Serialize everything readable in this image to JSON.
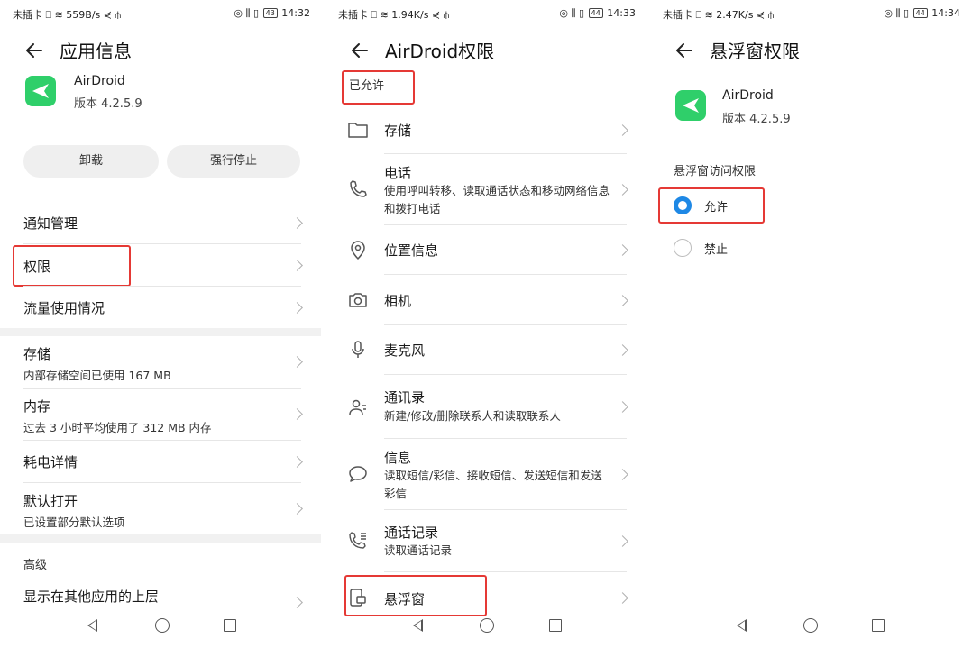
{
  "colors": {
    "accent": "#1e88e5",
    "app_green": "#2fcf6a",
    "highlight_red": "#e53935"
  },
  "screen1": {
    "status": {
      "left": "未插卡 ⎕ ≋ 559B/s ⋞ ⫛",
      "icons_right": "◎ ⫼ ▯",
      "battery": "43",
      "time": "14:32"
    },
    "title": "应用信息",
    "app": {
      "name": "AirDroid",
      "version": "版本 4.2.5.9"
    },
    "buttons": {
      "uninstall": "卸载",
      "force_stop": "强行停止"
    },
    "rows": {
      "notifications": "通知管理",
      "permissions": "权限",
      "data_usage": "流量使用情况",
      "storage": "存储",
      "storage_sub": "内部存储空间已使用 167 MB",
      "memory": "内存",
      "memory_sub": "过去 3 小时平均使用了 312 MB 内存",
      "battery": "耗电详情",
      "open_default": "默认打开",
      "open_default_sub": "已设置部分默认选项",
      "advanced": "高级",
      "draw_over": "显示在其他应用的上层"
    }
  },
  "screen2": {
    "status": {
      "left": "未插卡 ⎕ ≋ 1.94K/s ⋞ ⫛",
      "icons_right": "◎ ⫼ ▯",
      "battery": "44",
      "time": "14:33"
    },
    "title": "AirDroid权限",
    "allowed_label": "已允许",
    "items": {
      "storage": "存储",
      "phone": "电话",
      "phone_sub": "使用呼叫转移、读取通话状态和移动网络信息和拨打电话",
      "location": "位置信息",
      "camera": "相机",
      "microphone": "麦克风",
      "contacts": "通讯录",
      "contacts_sub": "新建/修改/删除联系人和读取联系人",
      "sms": "信息",
      "sms_sub": "读取短信/彩信、接收短信、发送短信和发送彩信",
      "call_log": "通话记录",
      "call_log_sub": "读取通话记录",
      "floating_window": "悬浮窗"
    }
  },
  "screen3": {
    "status": {
      "left": "未插卡 ⎕ ≋ 2.47K/s ⋞ ⫛",
      "icons_right": "◎ ⫼ ▯",
      "battery": "44",
      "time": "14:34"
    },
    "title": "悬浮窗权限",
    "app": {
      "name": "AirDroid",
      "version": "版本 4.2.5.9"
    },
    "section": "悬浮窗访问权限",
    "options": {
      "allow": "允许",
      "deny": "禁止"
    },
    "selected": "允许"
  }
}
